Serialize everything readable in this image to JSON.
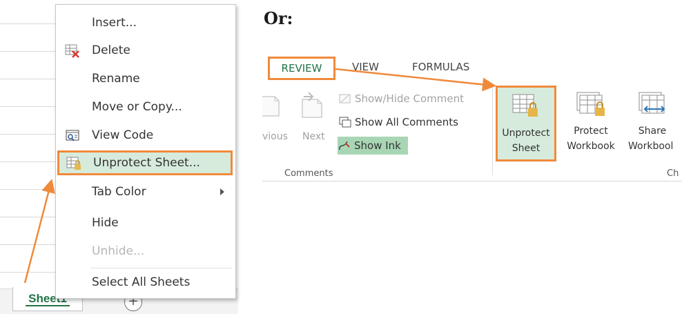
{
  "intro_label": "Or:",
  "context_menu": {
    "items": [
      {
        "label": "Insert...",
        "icon": "none",
        "disabled": false
      },
      {
        "label": "Delete",
        "icon": "delete-sheet-icon",
        "disabled": false
      },
      {
        "label": "Rename",
        "icon": "none",
        "disabled": false
      },
      {
        "label": "Move or Copy...",
        "icon": "none",
        "disabled": false
      },
      {
        "label": "View Code",
        "icon": "view-code-icon",
        "disabled": false
      },
      {
        "label": "Unprotect Sheet...",
        "icon": "unprotect-sheet-icon",
        "disabled": false,
        "highlighted": true
      },
      {
        "label": "Tab Color",
        "icon": "none",
        "disabled": false,
        "submenu": true
      },
      {
        "label": "Hide",
        "icon": "none",
        "disabled": false
      },
      {
        "label": "Unhide...",
        "icon": "none",
        "disabled": true
      },
      {
        "label": "Select All Sheets",
        "icon": "none",
        "disabled": false
      }
    ]
  },
  "sheet_tabs": {
    "active_tab": "Sheet1",
    "add_button": "+"
  },
  "ribbon": {
    "tabs": [
      "REVIEW",
      "VIEW",
      "FORMULAS"
    ],
    "active_tab": "REVIEW",
    "comments_group": {
      "label": "Comments",
      "previous_label": "vious",
      "next_label": "Next",
      "show_hide_comment": "Show/Hide Comment",
      "show_all_comments": "Show All Comments",
      "show_ink": "Show Ink"
    },
    "changes_group": {
      "label": "Ch",
      "unprotect_sheet": [
        "Unprotect",
        "Sheet"
      ],
      "protect_workbook": [
        "Protect",
        "Workbook"
      ],
      "share_workbook": [
        "Share",
        "Workbool"
      ]
    }
  },
  "colors": {
    "highlight_border": "#f08a3b",
    "highlight_fill": "#d7ebdc",
    "excel_green": "#217346",
    "ink_fill": "#a8d6b5"
  }
}
